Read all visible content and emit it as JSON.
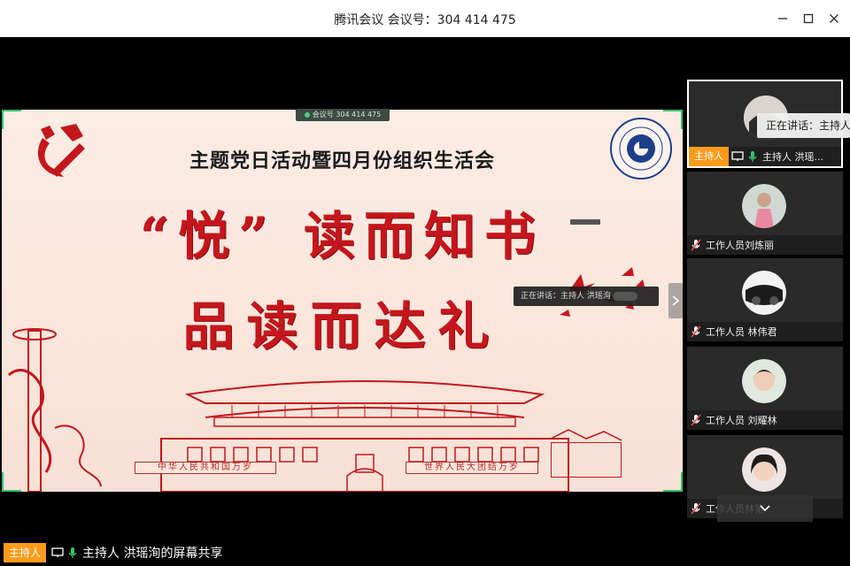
{
  "window": {
    "title": "腾讯会议 会议号：304 414 475"
  },
  "slide": {
    "title": "主题党日活动暨四月份组织生活会",
    "headline1": "“悦” 读而知书",
    "headline2": "品读而达礼",
    "banner_left": "中华人民共和国万岁",
    "banner_right": "世界人民大团结万岁",
    "top_pill_text": "会议号 304 414 475",
    "mini_speaking": "正在讲话：主持人 洪瑶洵",
    "colors": {
      "party_red": "#c4161c",
      "frame_green": "#35c46b"
    }
  },
  "participants": [
    {
      "badge": "主持人",
      "name": "主持人 洪瑶...",
      "active": true,
      "mic": "on",
      "sharing": true
    },
    {
      "name": "工作人员刘炼丽",
      "mic": "muted"
    },
    {
      "name": "工作人员 林伟君",
      "mic": "muted"
    },
    {
      "name": "工作人员 刘耀林",
      "mic": "muted"
    },
    {
      "name": "工作人员林第",
      "mic": "muted"
    }
  ],
  "speaking_popup": "正在讲话：主持人 洪",
  "status": {
    "badge": "主持人",
    "text": "主持人 洪瑶洵的屏幕共享"
  },
  "colors": {
    "host_badge": "#ff9b1a",
    "panel_bg": "#2a2a2a"
  }
}
